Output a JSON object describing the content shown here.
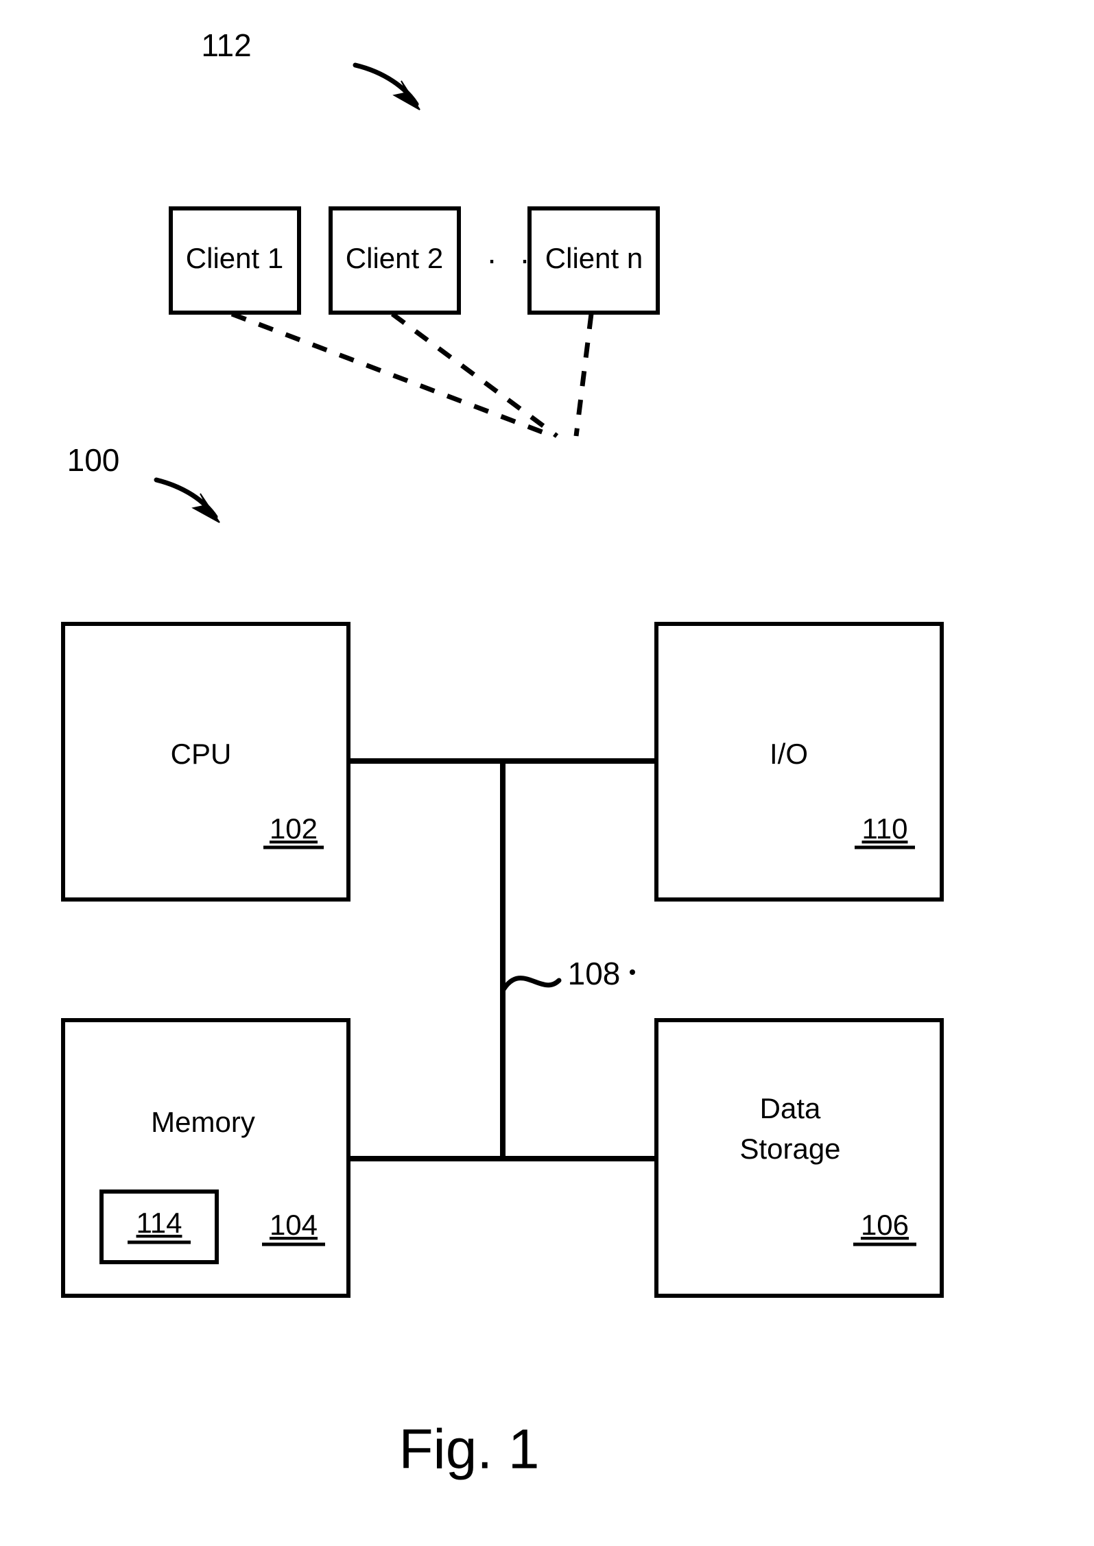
{
  "figure": {
    "caption": "Fig. 1",
    "callouts": {
      "client_group": "112",
      "system": "100",
      "bus": "108"
    },
    "ellipsis": "· · ·"
  },
  "clients": [
    {
      "label": "Client 1"
    },
    {
      "label": "Client 2"
    },
    {
      "label": "Client n"
    }
  ],
  "system_blocks": [
    {
      "label": "CPU",
      "ref": "102"
    },
    {
      "label": "I/O",
      "ref": "110"
    },
    {
      "label_line1": "Memory",
      "label_line2": "",
      "ref": "104",
      "inner_ref": "114"
    },
    {
      "label_line1": "Data",
      "label_line2": "Storage",
      "ref": "106"
    }
  ],
  "colors": {
    "stroke": "#000000",
    "fill": "#ffffff",
    "text": "#000000"
  }
}
